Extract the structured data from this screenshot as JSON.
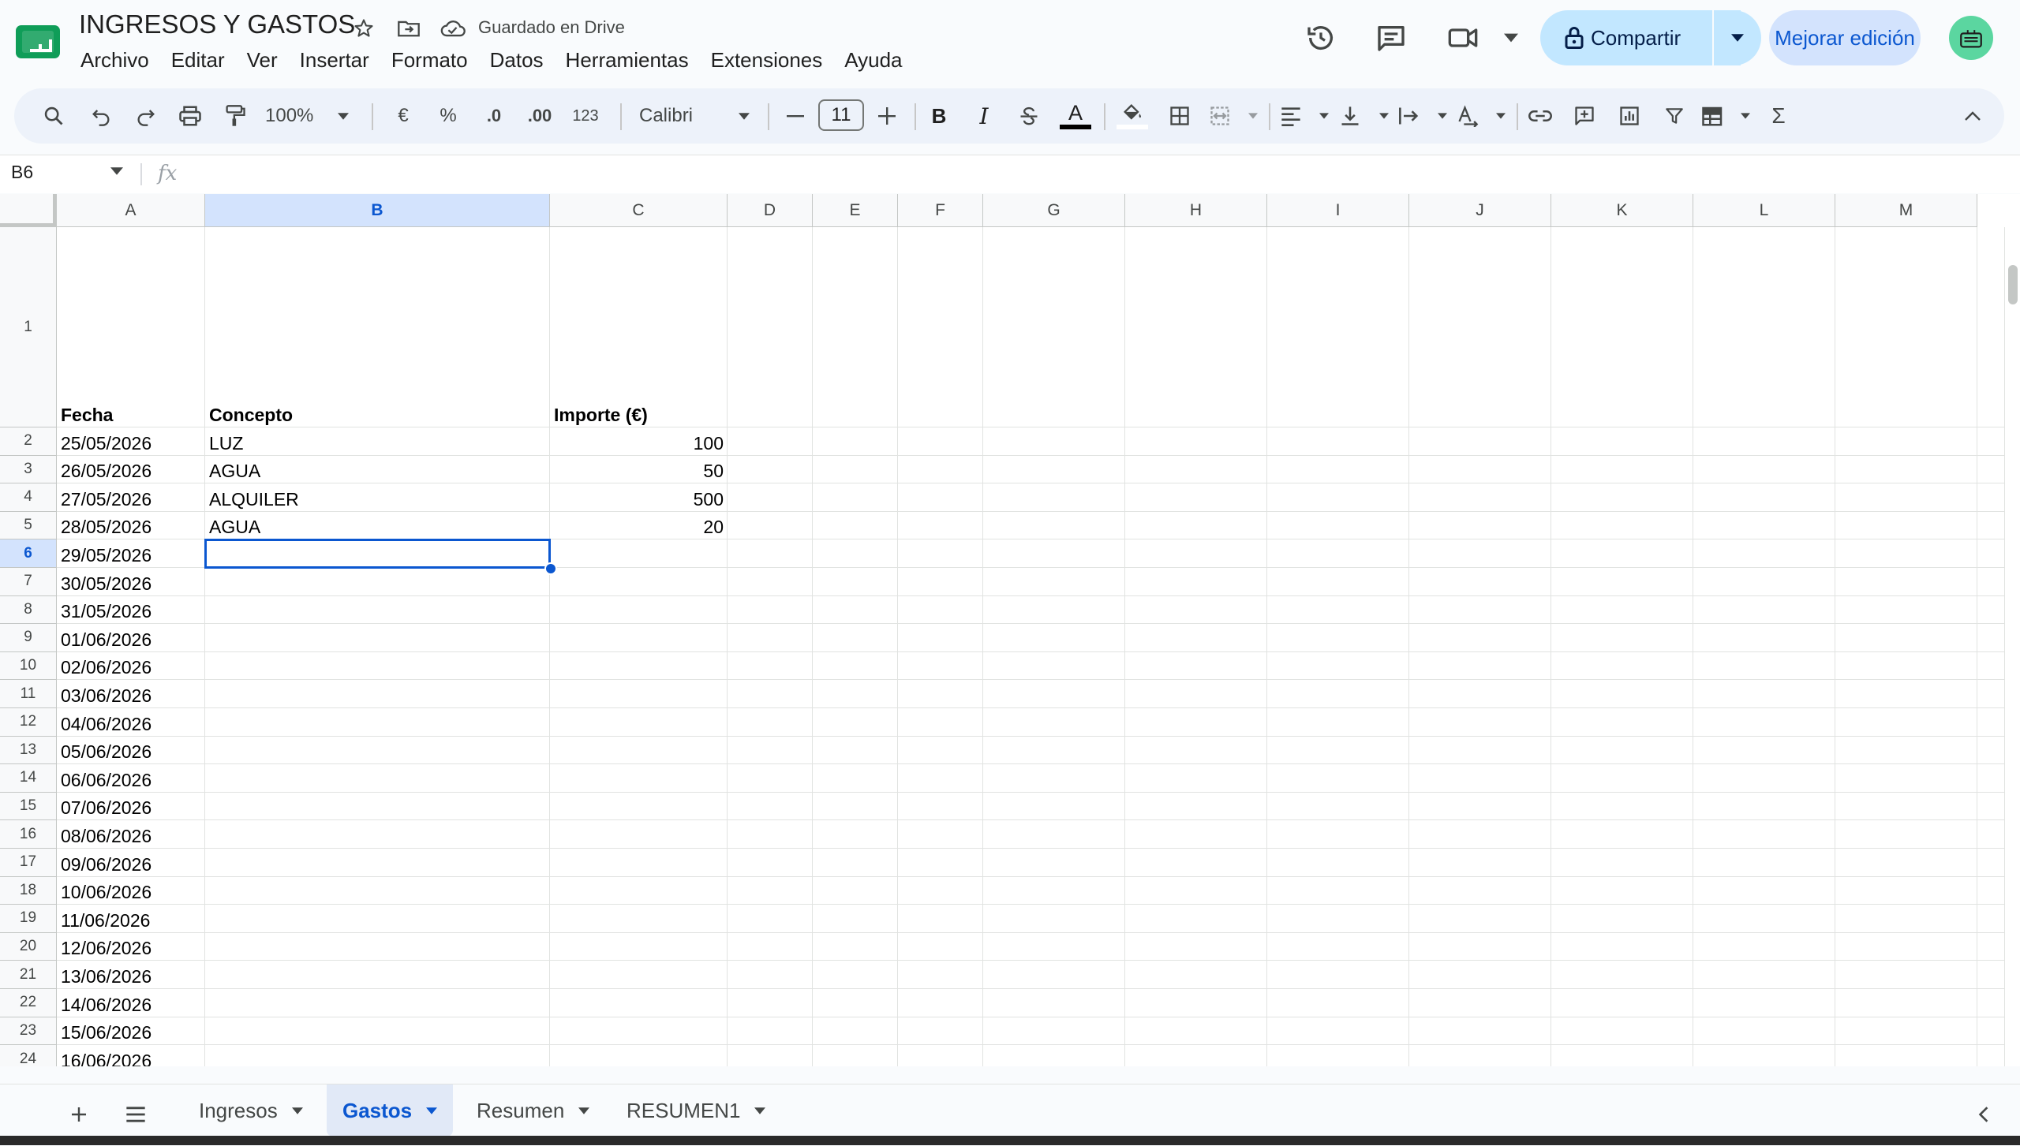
{
  "document": {
    "title": "INGRESOS Y GASTOS",
    "save_status": "Guardado en Drive"
  },
  "menu": [
    "Archivo",
    "Editar",
    "Ver",
    "Insertar",
    "Formato",
    "Datos",
    "Herramientas",
    "Extensiones",
    "Ayuda"
  ],
  "header": {
    "share_label": "Compartir",
    "upgrade_label": "Mejorar edición"
  },
  "toolbar": {
    "zoom": "100%",
    "currency": "€",
    "percent": "%",
    "decrease_decimals": ".0",
    "increase_decimals": ".00",
    "number_format": "123",
    "font": "Calibri",
    "font_size": "11",
    "bold": "B",
    "italic": "I",
    "text_color_letter": "A",
    "sum": "Σ"
  },
  "formula_bar": {
    "name_box": "B6",
    "fx": "fx",
    "content": ""
  },
  "grid": {
    "columns": [
      "A",
      "B",
      "C",
      "D",
      "E",
      "F",
      "G",
      "H",
      "I",
      "J",
      "K",
      "L",
      "M"
    ],
    "active_column": "B",
    "row_numbers": [
      "1",
      "2",
      "3",
      "4",
      "5",
      "6",
      "7",
      "8",
      "9",
      "10",
      "11",
      "12",
      "13",
      "14",
      "15",
      "16",
      "17",
      "18",
      "19",
      "20",
      "21",
      "22",
      "23",
      "24"
    ],
    "active_row": "6",
    "headers": {
      "a": "Fecha",
      "b": "Concepto",
      "c": "Importe (€)"
    },
    "rows": [
      {
        "a": "25/05/2026",
        "b": "LUZ",
        "c": "100"
      },
      {
        "a": "26/05/2026",
        "b": "AGUA",
        "c": "50"
      },
      {
        "a": "27/05/2026",
        "b": "ALQUILER",
        "c": "500"
      },
      {
        "a": "28/05/2026",
        "b": "AGUA",
        "c": "20"
      },
      {
        "a": "29/05/2026",
        "b": "",
        "c": ""
      },
      {
        "a": "30/05/2026",
        "b": "",
        "c": ""
      },
      {
        "a": "31/05/2026",
        "b": "",
        "c": ""
      },
      {
        "a": "01/06/2026",
        "b": "",
        "c": ""
      },
      {
        "a": "02/06/2026",
        "b": "",
        "c": ""
      },
      {
        "a": "03/06/2026",
        "b": "",
        "c": ""
      },
      {
        "a": "04/06/2026",
        "b": "",
        "c": ""
      },
      {
        "a": "05/06/2026",
        "b": "",
        "c": ""
      },
      {
        "a": "06/06/2026",
        "b": "",
        "c": ""
      },
      {
        "a": "07/06/2026",
        "b": "",
        "c": ""
      },
      {
        "a": "08/06/2026",
        "b": "",
        "c": ""
      },
      {
        "a": "09/06/2026",
        "b": "",
        "c": ""
      },
      {
        "a": "10/06/2026",
        "b": "",
        "c": ""
      },
      {
        "a": "11/06/2026",
        "b": "",
        "c": ""
      },
      {
        "a": "12/06/2026",
        "b": "",
        "c": ""
      },
      {
        "a": "13/06/2026",
        "b": "",
        "c": ""
      },
      {
        "a": "14/06/2026",
        "b": "",
        "c": ""
      },
      {
        "a": "15/06/2026",
        "b": "",
        "c": ""
      },
      {
        "a": "16/06/2026",
        "b": "",
        "c": ""
      }
    ]
  },
  "sheets": [
    {
      "label": "Ingresos",
      "active": false
    },
    {
      "label": "Gastos",
      "active": true
    },
    {
      "label": "Resumen",
      "active": false
    },
    {
      "label": "RESUMEN1",
      "active": false
    }
  ],
  "icons": {
    "title": [
      "star-icon",
      "move-to-folder-icon",
      "cloud-saved-icon"
    ],
    "header": [
      "version-history-icon",
      "comments-icon",
      "meet-video-icon",
      "lock-icon",
      "caret-down-icon",
      "avatar-icon"
    ],
    "toolbar": [
      "search-icon",
      "undo-icon",
      "redo-icon",
      "print-icon",
      "paint-format-icon",
      "strikethrough-icon",
      "fill-color-icon",
      "borders-icon",
      "merge-cells-icon",
      "align-left-icon",
      "valign-bottom-icon",
      "text-wrap-icon",
      "text-rotate-icon",
      "link-icon",
      "comment-add-icon",
      "chart-icon",
      "filter-icon",
      "table-icon",
      "collapse-icon"
    ],
    "sheetbar": [
      "add-sheet-icon",
      "all-sheets-icon",
      "side-panel-chevron-icon"
    ]
  },
  "colors": {
    "accent": "#0b57d0",
    "share_bg": "#c2e7ff",
    "upgrade_bg": "#d3e3fd",
    "selection": "#0b57d0",
    "logo_green": "#0f9d58"
  }
}
